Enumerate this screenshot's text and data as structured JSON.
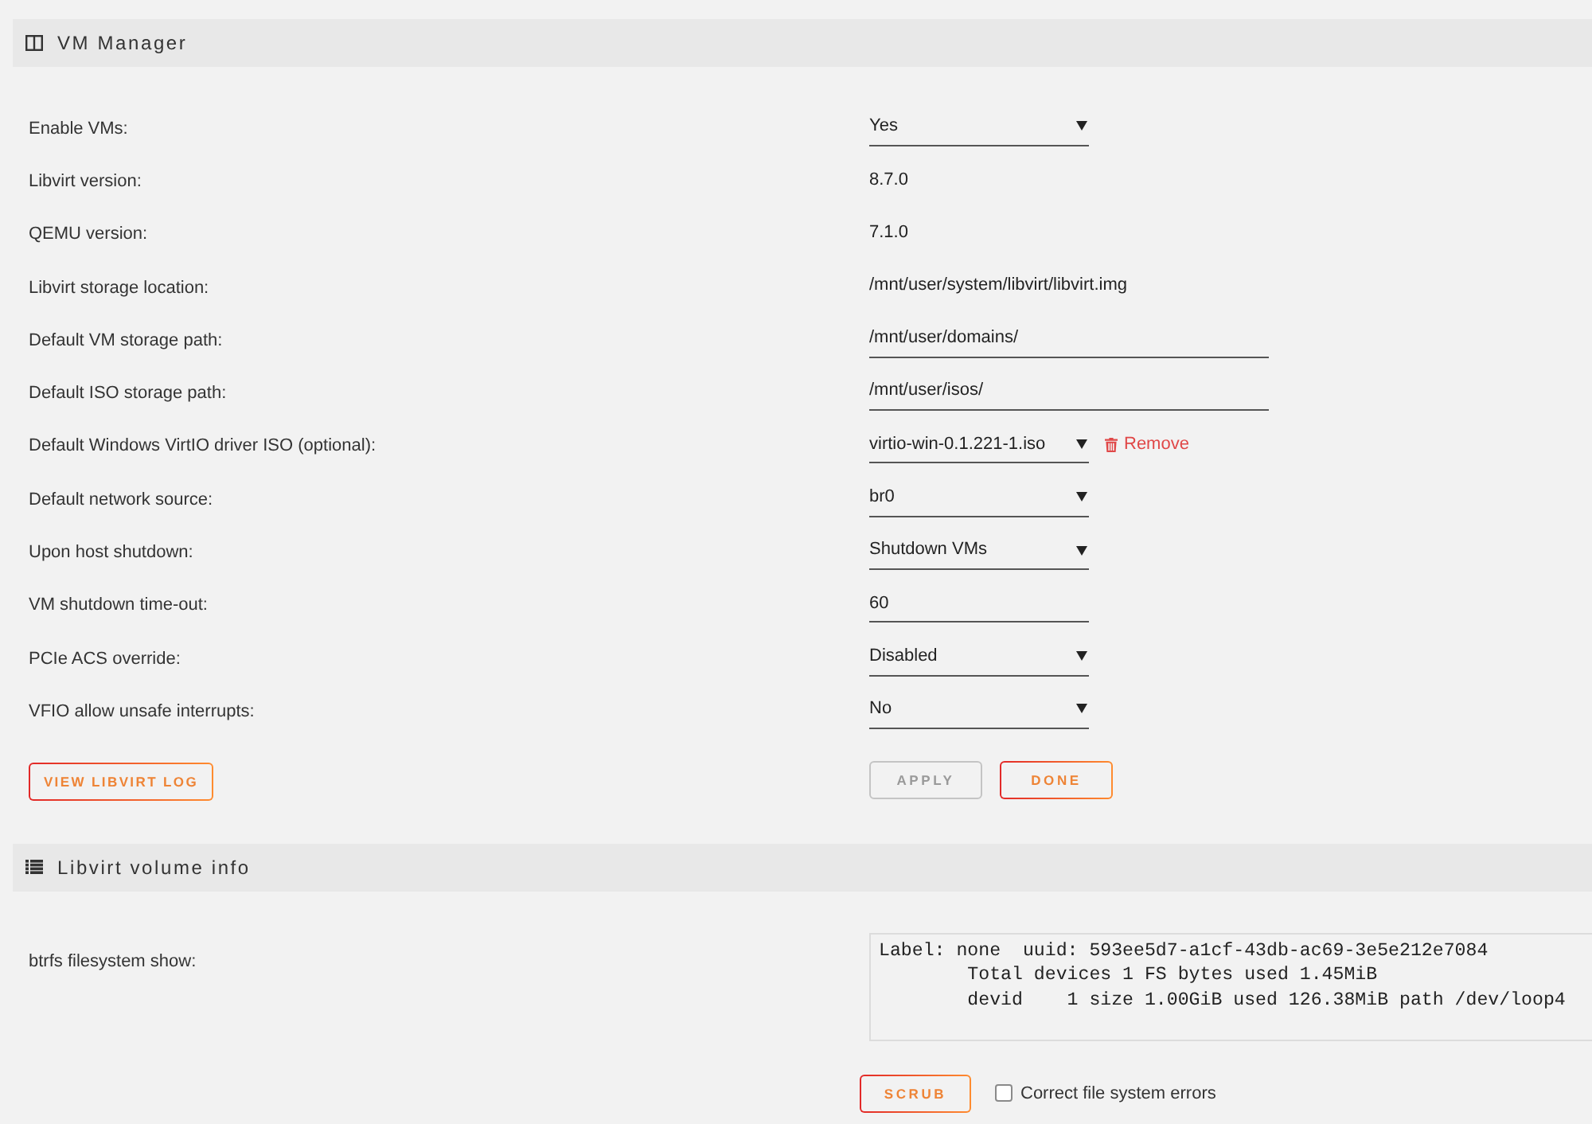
{
  "vm_manager": {
    "title": "VM Manager",
    "settings": [
      {
        "label": "Enable VMs:",
        "kind": "select",
        "value": "Yes"
      },
      {
        "label": "Libvirt version:",
        "kind": "text",
        "value": "8.7.0"
      },
      {
        "label": "QEMU version:",
        "kind": "text",
        "value": "7.1.0"
      },
      {
        "label": "Libvirt storage location:",
        "kind": "text",
        "value": "/mnt/user/system/libvirt/libvirt.img"
      },
      {
        "label": "Default VM storage path:",
        "kind": "path",
        "value": "/mnt/user/domains/"
      },
      {
        "label": "Default ISO storage path:",
        "kind": "path",
        "value": "/mnt/user/isos/"
      },
      {
        "label": "Default Windows VirtIO driver ISO (optional):",
        "kind": "select",
        "value": "virtio-win-0.1.221-1.iso",
        "link": "Remove"
      },
      {
        "label": "Default network source:",
        "kind": "select",
        "value": "br0"
      },
      {
        "label": "Upon host shutdown:",
        "kind": "select",
        "value": "Shutdown VMs"
      },
      {
        "label": "VM shutdown time-out:",
        "kind": "number",
        "value": "60"
      },
      {
        "label": "PCIe ACS override:",
        "kind": "select",
        "value": "Disabled"
      },
      {
        "label": "VFIO allow unsafe interrupts:",
        "kind": "select",
        "value": "No"
      }
    ],
    "log_button": {
      "label": "VIEW LIBVIRT LOG"
    },
    "buttons": [
      {
        "label": "APPLY",
        "disabled": true
      },
      {
        "label": "DONE",
        "disabled": false
      }
    ]
  },
  "volume_info": {
    "title": "Libvirt volume info",
    "label": "btrfs filesystem show:",
    "output": "Label: none  uuid: 593ee5d7-a1cf-43db-ac69-3e5e212e7084\n        Total devices 1 FS bytes used 1.45MiB\n        devid    1 size 1.00GiB used 126.38MiB path /dev/loop4",
    "scrub_button": {
      "label": "SCRUB"
    },
    "checkbox": {
      "label": "Correct file system errors",
      "checked": false
    }
  }
}
